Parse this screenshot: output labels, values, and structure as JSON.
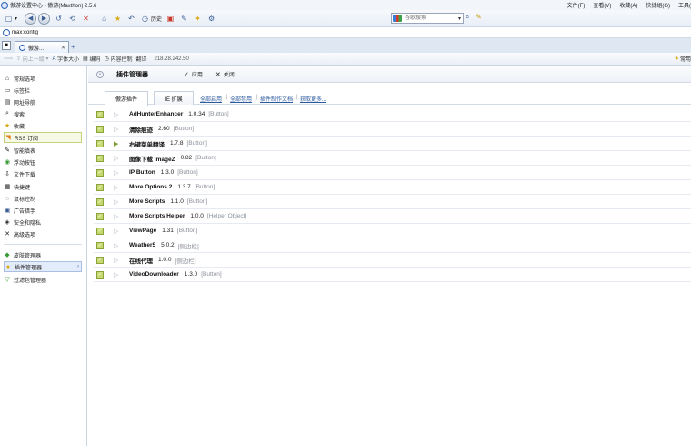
{
  "window": {
    "title": "傲游设置中心 - 傲游(Maxthon) 2.5.6",
    "menu": [
      "文件(F)",
      "查看(V)",
      "收藏(A)",
      "快捷组(G)",
      "工具("
    ]
  },
  "toolbar": {
    "history_label": "历史",
    "search_placeholder": "谷歌搜索"
  },
  "address": {
    "url": "max:config"
  },
  "tab": {
    "label": "傲游..."
  },
  "navbar": {
    "up_label": "向上一级",
    "font_label": "字体大小",
    "encode_label": "编码",
    "content_label": "内容控制",
    "translate_label": "翻译",
    "ip": "218.28.242.50",
    "right_label": "常用"
  },
  "sidebar": {
    "items": [
      {
        "label": "常规选项",
        "icon": "house-icon"
      },
      {
        "label": "标签栏",
        "icon": "tabbar-icon"
      },
      {
        "label": "网址导航",
        "icon": "nav-icon"
      },
      {
        "label": "搜索",
        "icon": "search-icon"
      },
      {
        "label": "收藏",
        "icon": "star-icon"
      },
      {
        "label": "RSS 订阅",
        "icon": "rss-icon"
      },
      {
        "label": "智能填表",
        "icon": "form-icon"
      },
      {
        "label": "浮动按钮",
        "icon": "float-icon"
      },
      {
        "label": "文件下载",
        "icon": "download-icon"
      },
      {
        "label": "快捷键",
        "icon": "keyboard-icon"
      },
      {
        "label": "鼠标控制",
        "icon": "mouse-icon"
      },
      {
        "label": "广告猎手",
        "icon": "adhunter-icon"
      },
      {
        "label": "安全和隐私",
        "icon": "shield-icon"
      },
      {
        "label": "高级选项",
        "icon": "advanced-icon"
      }
    ],
    "items2": [
      {
        "label": "皮肤管理器",
        "icon": "skin-icon"
      },
      {
        "label": "插件管理器",
        "icon": "plugin-icon"
      },
      {
        "label": "过滤包管理器",
        "icon": "filter-icon"
      }
    ]
  },
  "main": {
    "title": "插件管理器",
    "apply_label": "应用",
    "close_label": "关闭",
    "tabs": [
      "傲游插件",
      "IE 扩展"
    ],
    "links": [
      "全部启用",
      "全部禁用",
      "插件制作文档",
      "获取更多..."
    ],
    "plugins": [
      {
        "name": "AdHunterEnhancer",
        "version": "1.0.34",
        "type": "[Button]",
        "active": false
      },
      {
        "name": "清除痕迹",
        "version": "2.60",
        "type": "[Button]",
        "active": false
      },
      {
        "name": "右键菜单翻译",
        "version": "1.7.8",
        "type": "[Button]",
        "active": true
      },
      {
        "name": "图像下载 ImageZ",
        "version": "0.82",
        "type": "[Button]",
        "active": false
      },
      {
        "name": "IP Button",
        "version": "1.3.0",
        "type": "[Button]",
        "active": false
      },
      {
        "name": "More Options 2",
        "version": "1.3.7",
        "type": "[Button]",
        "active": false
      },
      {
        "name": "More Scripts",
        "version": "1.1.0",
        "type": "[Button]",
        "active": false
      },
      {
        "name": "More Scripts Helper",
        "version": "1.0.0",
        "type": "[Helper Object]",
        "active": false
      },
      {
        "name": "ViewPage",
        "version": "1.31",
        "type": "[Button]",
        "active": false
      },
      {
        "name": "Weather5",
        "version": "5.0.2",
        "type": "[侧边栏]",
        "active": false
      },
      {
        "name": "在线代理",
        "version": "1.0.0",
        "type": "[侧边栏]",
        "active": false
      },
      {
        "name": "VideoDownloader",
        "version": "1.3.0",
        "type": "[Button]",
        "active": false
      }
    ]
  }
}
